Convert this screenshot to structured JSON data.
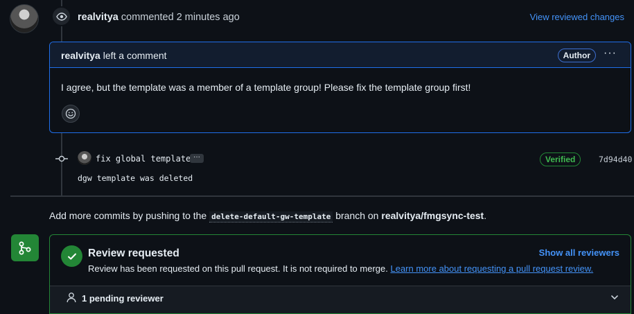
{
  "comment_header": {
    "author": "realvitya",
    "action": "commented",
    "time": "2 minutes ago",
    "view_changes_label": "View reviewed changes"
  },
  "comment": {
    "author": "realvitya",
    "action": "left a comment",
    "badge": "Author",
    "menu_label": "···",
    "body": "I agree, but the template was a member of a template group! Please fix the template group first!"
  },
  "commit": {
    "title": "fix global template",
    "ellipsis": "···",
    "verified_label": "Verified",
    "sha": "7d94d40",
    "description": "dgw template was deleted"
  },
  "add_commits": {
    "prefix": "Add more commits by pushing to the",
    "branch": "delete-default-gw-template",
    "middle": "branch on",
    "repo": "realvitya/fmgsync-test",
    "suffix": "."
  },
  "review": {
    "title": "Review requested",
    "show_all_label": "Show all reviewers",
    "description": "Review has been requested on this pull request. It is not required to merge.",
    "learn_more_link": "Learn more about requesting a pull request review.",
    "pending_label": "1 pending reviewer"
  },
  "colors": {
    "background": "#0d1117",
    "accent_blue": "#4493f8",
    "success_green": "#238636",
    "verified_green": "#3fb950"
  }
}
